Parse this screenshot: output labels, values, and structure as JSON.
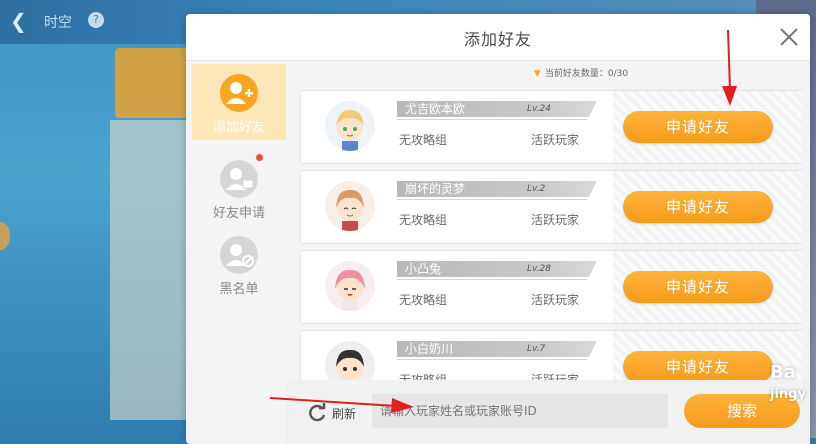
{
  "background": {
    "title": "时空",
    "help": "?"
  },
  "dialog": {
    "title": "添加好友",
    "friend_count": "当前好友数量：0/30"
  },
  "sidebar": {
    "items": [
      {
        "label": "添加好友",
        "icon": "add-user-icon",
        "active": true
      },
      {
        "label": "好友申请",
        "icon": "friend-request-icon",
        "active": false,
        "badge": true
      },
      {
        "label": "黑名单",
        "icon": "blacklist-icon",
        "active": false
      }
    ]
  },
  "friends": [
    {
      "name": "尤吉欧本欧",
      "level": "Lv.24",
      "group": "无攻略组",
      "status": "活跃玩家",
      "button": "申请好友",
      "hair": "#f3c97a"
    },
    {
      "name": "崩坏的灵梦",
      "level": "Lv.2",
      "group": "无攻略组",
      "status": "活跃玩家",
      "button": "申请好友",
      "hair": "#d99a6c"
    },
    {
      "name": "小凸兔",
      "level": "Lv.28",
      "group": "无攻略组",
      "status": "活跃玩家",
      "button": "申请好友",
      "hair": "#ef8fa0"
    },
    {
      "name": "小白奶川",
      "level": "Lv.7",
      "group": "无攻略组",
      "status": "活跃玩家",
      "button": "申请好友",
      "hair": "#333333"
    }
  ],
  "bottom": {
    "refresh_label": "刷新",
    "search_placeholder": "请输入玩家姓名或玩家账号ID",
    "search_label": "搜索"
  },
  "watermark": {
    "line1": "Ba",
    "line2": "jingy"
  },
  "colors": {
    "accent": "#f5a623",
    "annotation": "#e02020"
  }
}
